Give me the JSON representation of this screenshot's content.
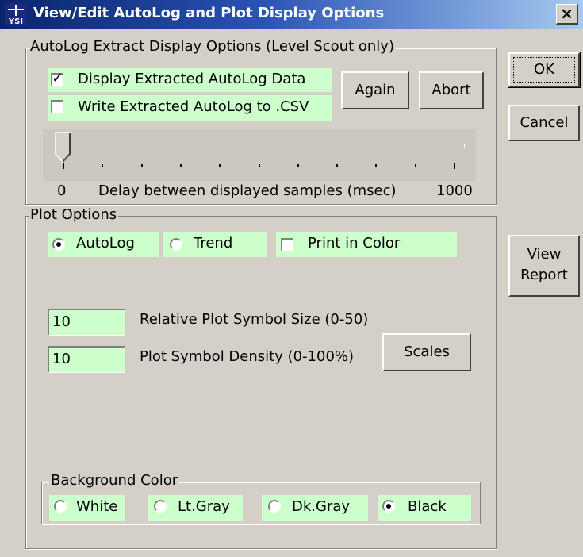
{
  "title": "View/Edit AutoLog and Plot Display Options",
  "icons": {
    "app": "ysi-logo-icon",
    "close": "close-icon"
  },
  "buttons": {
    "close": "×",
    "ok": "OK",
    "cancel": "Cancel",
    "view_report_line1": "View",
    "view_report_line2": "Report",
    "again": "Again",
    "abort": "Abort",
    "scales": "Scales"
  },
  "autolog": {
    "legend": "AutoLog Extract Display Options (Level Scout only)",
    "display_extracted": {
      "label": "Display Extracted AutoLog Data",
      "checked": true
    },
    "write_csv": {
      "label": "Write Extracted AutoLog to .CSV",
      "checked": false
    },
    "slider": {
      "min_label": "0",
      "caption": "Delay between displayed samples (msec)",
      "max_label": "1000",
      "value": 0
    }
  },
  "plot": {
    "legend": "Plot Options",
    "mode": {
      "autolog": "AutoLog",
      "trend": "Trend",
      "selected": "AutoLog"
    },
    "print_color": {
      "label": "Print in Color",
      "checked": false
    },
    "symbol_size": {
      "value": "10",
      "label": "Relative Plot Symbol Size (0-50)"
    },
    "symbol_density": {
      "value": "10",
      "label": "Plot Symbol Density (0-100%)"
    },
    "background": {
      "legend": "Background Color",
      "options": [
        "White",
        "Lt.Gray",
        "Dk.Gray",
        "Black"
      ],
      "selected": "Black"
    }
  },
  "colors": {
    "field_bg": "#ccffcc",
    "face": "#d4d0c8",
    "title_start": "#0a246a",
    "title_end": "#a6caf0"
  }
}
